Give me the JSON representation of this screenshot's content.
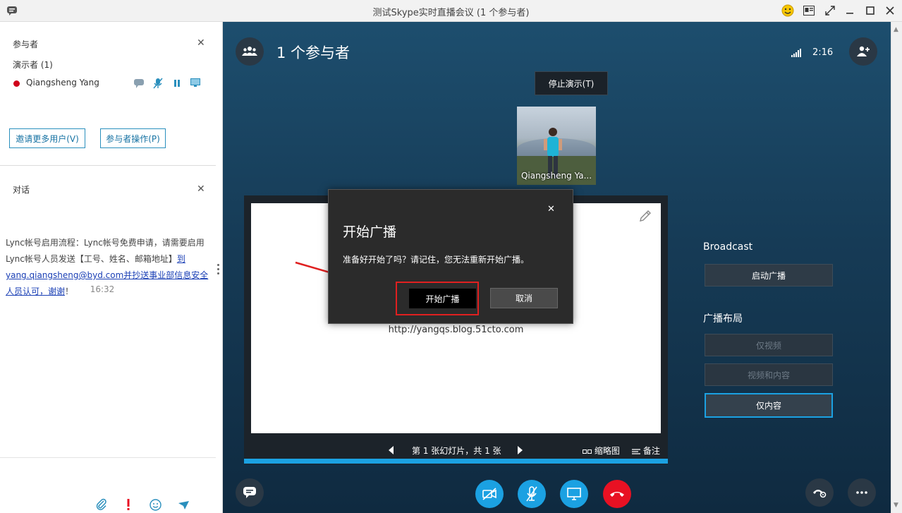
{
  "window": {
    "title": "测试Skype实时直播会议 (1 个参与者)"
  },
  "left": {
    "participants": {
      "heading": "参与者",
      "presenters_label": "演示者 (1)",
      "presenter_name": "Qiangsheng Yang",
      "invite_button": "邀请更多用户(V)",
      "actions_button": "参与者操作(P)"
    },
    "conversation": {
      "heading": "对话",
      "message_plain": "Lync帐号启用流程：Lync帐号免费申请，请需要启用Lync帐号人员发送【工号、姓名、邮箱地址】",
      "message_link": "到yang.qiangsheng@byd.com并抄送事业部信息安全人员认可，谢谢",
      "message_tail": "！",
      "time": "16:32"
    }
  },
  "stage": {
    "title": "1 个参与者",
    "clock": "2:16",
    "stop_presenting": "停止演示(T)",
    "video_name": "Qiangsheng Ya...",
    "slide": {
      "url_text": "http://yangqs.blog.51cto.com",
      "counter": "第 1 张幻灯片，共 1 张",
      "thumbnails": "缩略图",
      "notes": "备注"
    },
    "broadcast": {
      "heading": "Broadcast",
      "start_button": "启动广播",
      "layout_heading": "广播布局",
      "layout_options": [
        "仅视频",
        "视频和内容",
        "仅内容"
      ],
      "selected_layout": "仅内容"
    }
  },
  "dialog": {
    "title": "开始广播",
    "message": "准备好开始了吗？请记住，您无法重新开始广播。",
    "start_button": "开始广播",
    "cancel_button": "取消"
  },
  "colors": {
    "accent_blue": "#1ba1e2",
    "end_call_red": "#e81123",
    "presence_red": "#d0021b",
    "highlight_red": "#e02020"
  }
}
